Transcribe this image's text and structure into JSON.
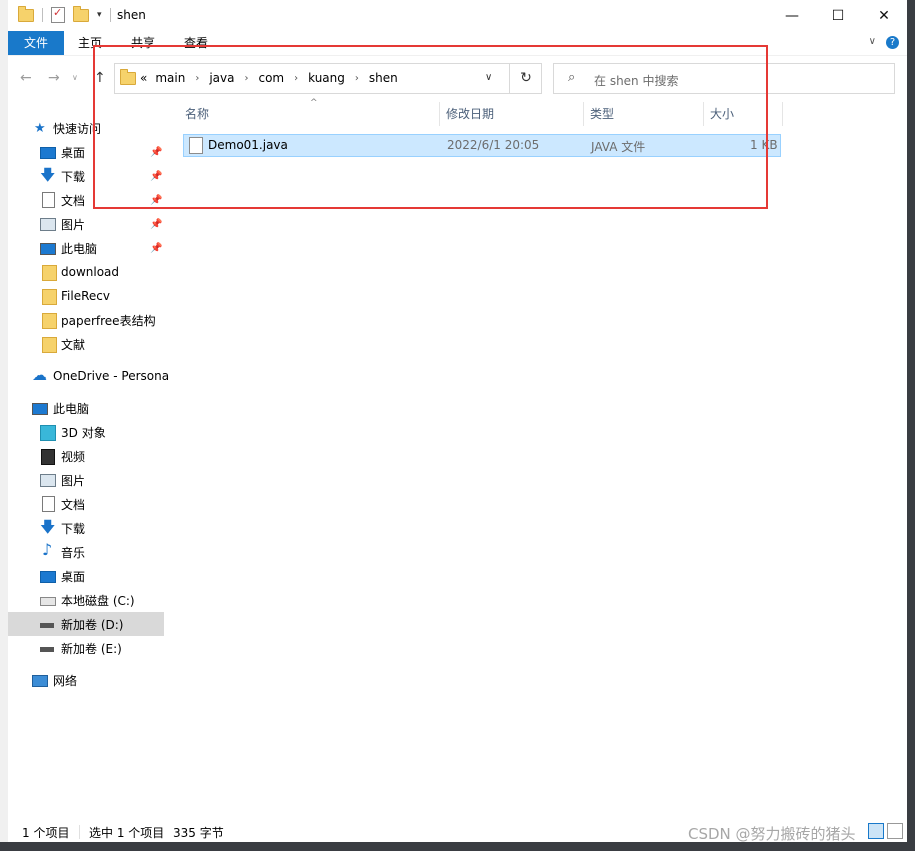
{
  "window": {
    "title": "shen",
    "controls": {
      "minimize": "—",
      "maximize": "☐",
      "close": "✕"
    }
  },
  "ribbon": {
    "tabs": [
      "文件",
      "主页",
      "共享",
      "查看"
    ],
    "expand": "∨",
    "help": "?"
  },
  "nav": {
    "back": "←",
    "forward": "→",
    "history": "∨",
    "up": "↑",
    "breadcrumb": [
      "«",
      "main",
      "java",
      "com",
      "kuang",
      "shen"
    ],
    "refresh": "↻",
    "search_placeholder": "在 shen 中搜索"
  },
  "sidebar": {
    "quick_access": "快速访问",
    "pinned": [
      {
        "label": "桌面",
        "icon": "desktop-icon"
      },
      {
        "label": "下载",
        "icon": "download-icon"
      },
      {
        "label": "文档",
        "icon": "document-icon"
      },
      {
        "label": "图片",
        "icon": "pictures-icon"
      },
      {
        "label": "此电脑",
        "icon": "computer-icon"
      }
    ],
    "recent_folders": [
      "download",
      "FileRecv",
      "paperfree表结构",
      "文献"
    ],
    "onedrive": "OneDrive - Persona",
    "this_pc": "此电脑",
    "pc_items": [
      {
        "label": "3D 对象",
        "icon": "3d-objects-icon"
      },
      {
        "label": "视频",
        "icon": "video-icon"
      },
      {
        "label": "图片",
        "icon": "pictures-icon"
      },
      {
        "label": "文档",
        "icon": "document-icon"
      },
      {
        "label": "下载",
        "icon": "download-icon"
      },
      {
        "label": "音乐",
        "icon": "music-icon"
      },
      {
        "label": "桌面",
        "icon": "desktop-icon"
      },
      {
        "label": "本地磁盘 (C:)",
        "icon": "local-disk-icon"
      },
      {
        "label": "新加卷 (D:)",
        "icon": "drive-icon"
      },
      {
        "label": "新加卷 (E:)",
        "icon": "drive-icon"
      }
    ],
    "network": "网络"
  },
  "columns": {
    "name": "名称",
    "date": "修改日期",
    "type": "类型",
    "size": "大小"
  },
  "files": [
    {
      "name": "Demo01.java",
      "date": "2022/6/1 20:05",
      "type": "JAVA 文件",
      "size": "1 KB"
    }
  ],
  "status": {
    "count": "1 个项目",
    "selected": "选中 1 个项目",
    "size": "335 字节"
  },
  "watermark": "CSDN @努力搬砖的猪头",
  "colors": {
    "accent": "#1979ca",
    "selection": "#cce8ff",
    "annotation": "#e53935"
  }
}
